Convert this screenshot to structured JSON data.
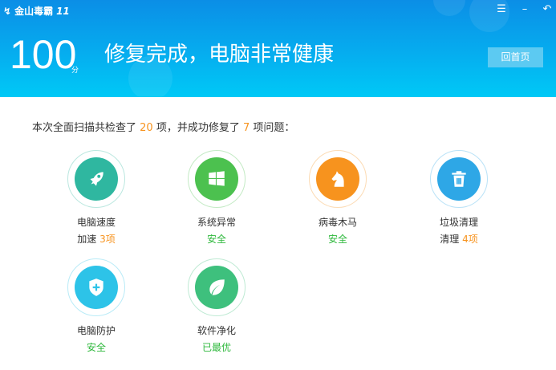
{
  "app": {
    "name": "金山毒霸",
    "version": "11"
  },
  "window": {
    "menu_icon": "menu-icon",
    "minimize_icon": "minimize-icon",
    "back_icon": "back-icon"
  },
  "header": {
    "score": "100",
    "score_unit": "分",
    "headline": "修复完成，电脑非常健康",
    "home_button": "回首页"
  },
  "summary": {
    "prefix": "本次全面扫描共检查了",
    "checked": "20",
    "mid": "项，并成功修复了",
    "fixed": "7",
    "suffix": "项问题："
  },
  "items": [
    {
      "label": "电脑速度",
      "status_prefix": "加速",
      "status_value": "3项",
      "icon": "rocket-icon",
      "color": "#2fb7a0"
    },
    {
      "label": "系统异常",
      "status_prefix": "",
      "status_value": "安全",
      "icon": "windows-icon",
      "color": "#4cc14f"
    },
    {
      "label": "病毒木马",
      "status_prefix": "",
      "status_value": "安全",
      "icon": "horse-icon",
      "color": "#f7931e"
    },
    {
      "label": "垃圾清理",
      "status_prefix": "清理",
      "status_value": "4项",
      "icon": "trash-icon",
      "color": "#2ea7e6"
    },
    {
      "label": "电脑防护",
      "status_prefix": "",
      "status_value": "安全",
      "icon": "shield-icon",
      "color": "#2dc3e8"
    },
    {
      "label": "软件净化",
      "status_prefix": "",
      "status_value": "已最优",
      "icon": "leaf-icon",
      "color": "#3ec07d"
    }
  ]
}
